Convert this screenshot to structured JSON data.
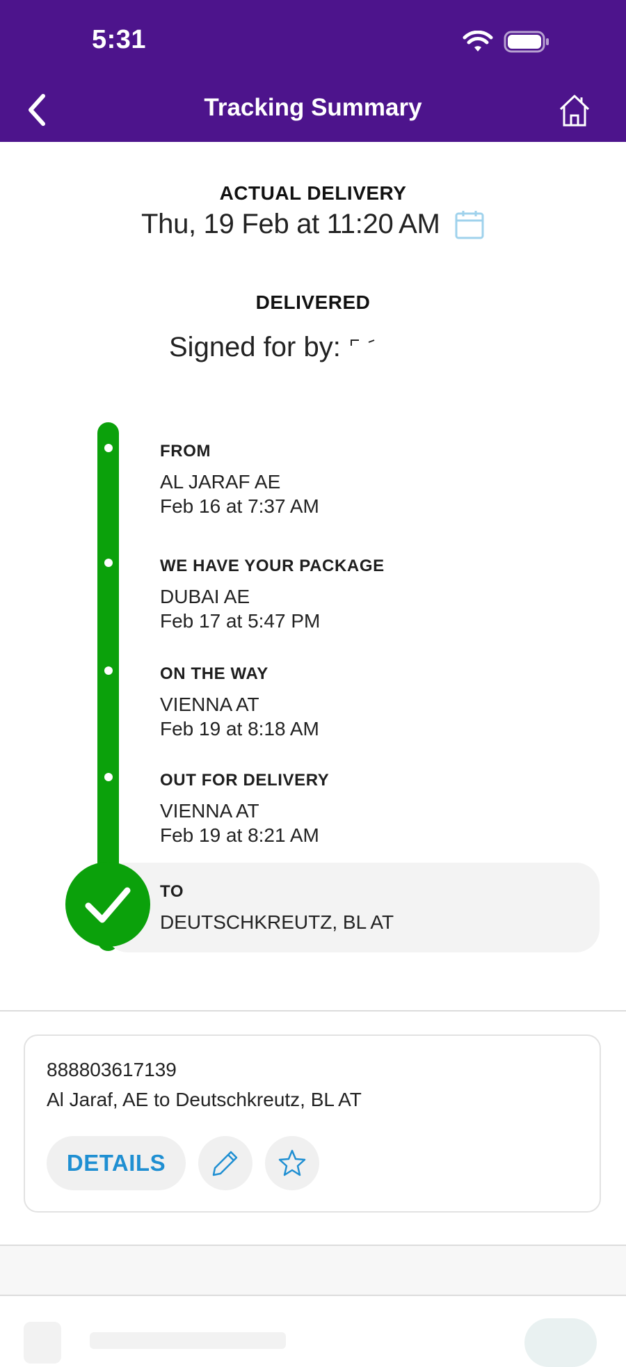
{
  "status_bar": {
    "time": "5:31",
    "wifi_icon": "wifi-icon",
    "battery_icon": "battery-icon"
  },
  "header": {
    "title": "Tracking Summary",
    "back_icon": "chevron-left-icon",
    "home_icon": "home-icon",
    "background": "#4d148c"
  },
  "delivery": {
    "label": "ACTUAL DELIVERY",
    "date": "Thu, 19 Feb at 11:20 AM",
    "calendar_icon": "calendar-icon",
    "status": "DELIVERED",
    "signed_label": "Signed for by: "
  },
  "timeline": {
    "color": "#0ba10b",
    "steps": [
      {
        "title": "FROM",
        "location": "AL JARAF AE",
        "time": "Feb 16 at 7:37 AM"
      },
      {
        "title": "WE HAVE YOUR PACKAGE",
        "location": "DUBAI AE",
        "time": "Feb 17 at 5:47 PM"
      },
      {
        "title": "ON THE WAY",
        "location": "VIENNA AT",
        "time": "Feb 19 at 8:18 AM"
      },
      {
        "title": "OUT FOR DELIVERY",
        "location": "VIENNA AT",
        "time": "Feb 19 at 8:21 AM"
      }
    ],
    "destination": {
      "title": "TO",
      "location": "DEUTSCHKREUTZ, BL  AT",
      "icon": "checkmark-icon"
    }
  },
  "shipment": {
    "tracking_number": "888803617139",
    "route": "Al Jaraf, AE to Deutschkreutz, BL AT",
    "details_label": "DETAILS",
    "edit_icon": "pencil-icon",
    "favorite_icon": "star-icon",
    "accent": "#1f8fd2"
  }
}
